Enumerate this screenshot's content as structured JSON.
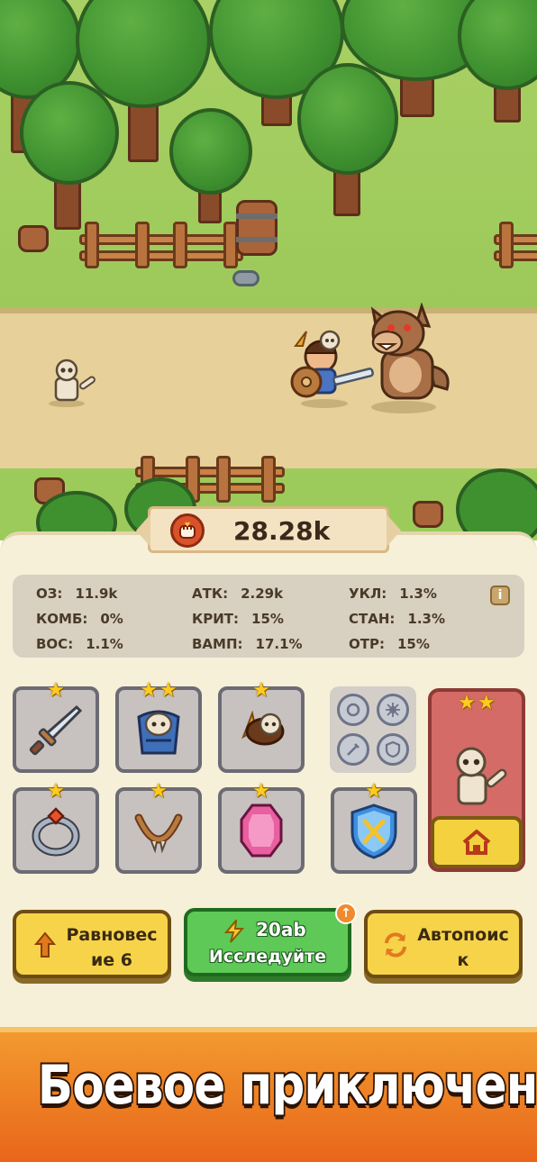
{
  "power": {
    "value": "28.28k"
  },
  "stats": [
    {
      "label": "ОЗ:",
      "value": "11.9k"
    },
    {
      "label": "АТК:",
      "value": "2.29k"
    },
    {
      "label": "УКЛ:",
      "value": "1.3%"
    },
    {
      "label": "КОМБ:",
      "value": "0%"
    },
    {
      "label": "КРИТ:",
      "value": "15%"
    },
    {
      "label": "СТАН:",
      "value": "1.3%"
    },
    {
      "label": "ВОС:",
      "value": "1.1%"
    },
    {
      "label": "ВАМП:",
      "value": "17.1%"
    },
    {
      "label": "ОТР:",
      "value": "15%"
    }
  ],
  "equipment": [
    {
      "icon": "sword-icon",
      "stars": 1
    },
    {
      "icon": "armor-icon",
      "stars": 2
    },
    {
      "icon": "helmet-icon",
      "stars": 1
    },
    {
      "icon": "ring-icon",
      "stars": 1
    },
    {
      "icon": "necklace-icon",
      "stars": 1
    },
    {
      "icon": "gem-icon",
      "stars": 1
    },
    {
      "icon": "shield-badge-icon",
      "stars": 1
    }
  ],
  "pet": {
    "stars": 2
  },
  "buttons": {
    "balance": "Равновес\nие 6",
    "research_cost": "20ab",
    "research": "Исследуйте",
    "autosearch": "Автопоис\nк"
  },
  "banner": {
    "text": "Боевое приключение"
  },
  "colors": {
    "banner": "#ee7d22",
    "research_button": "#5ec957",
    "action_button": "#f7d34a",
    "pet_card": "#d56b66"
  }
}
